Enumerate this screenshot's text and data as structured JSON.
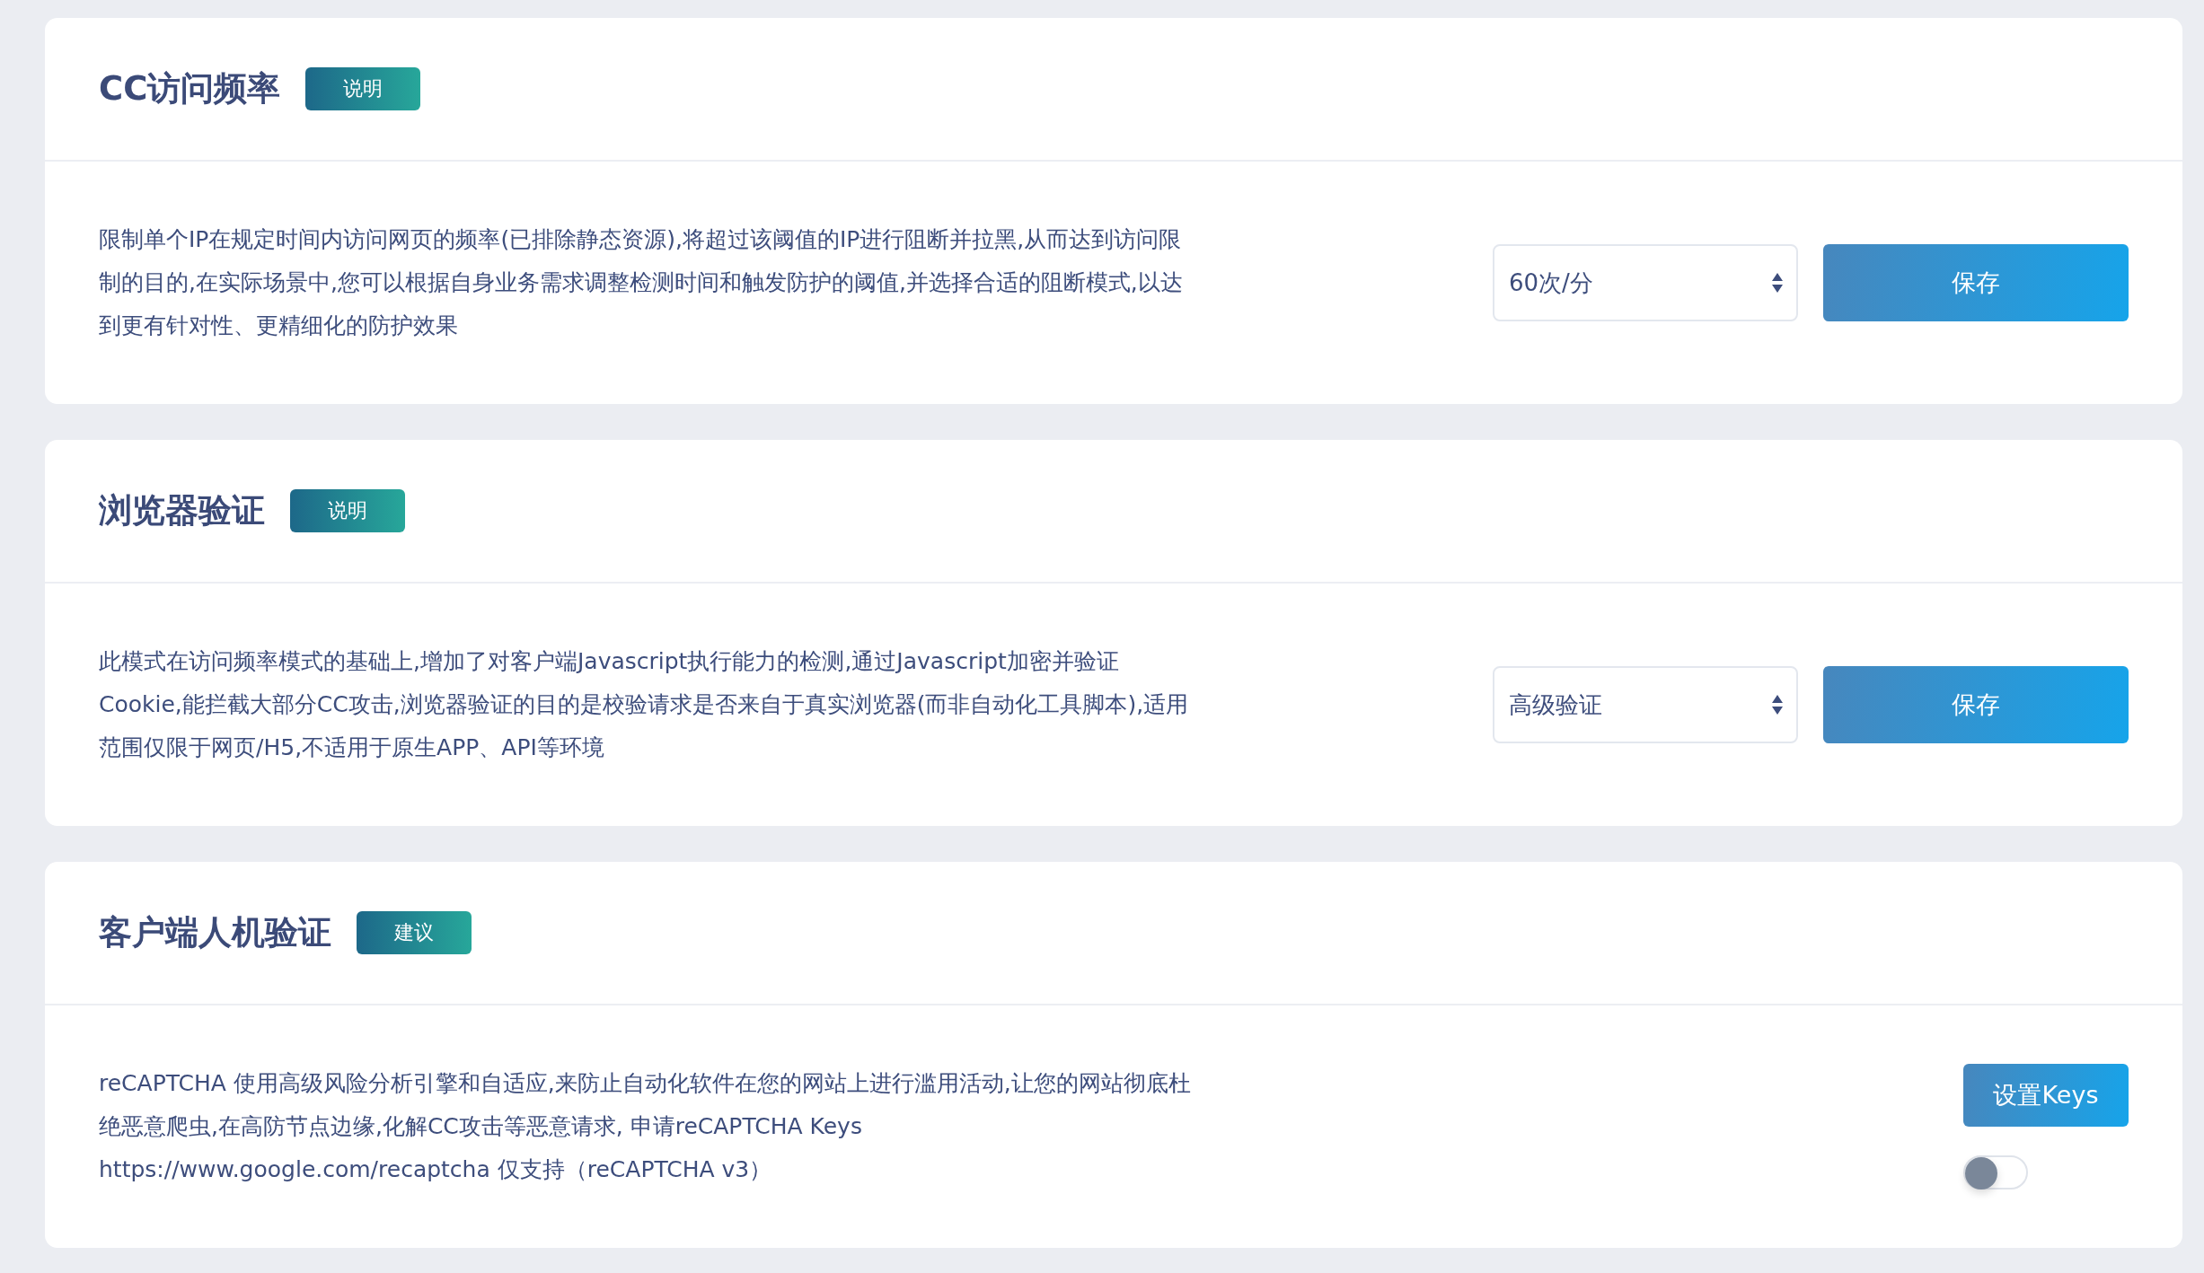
{
  "sections": [
    {
      "title": "CC访问频率",
      "badge": "说明",
      "description": "限制单个IP在规定时间内访问网页的频率(已排除静态资源),将超过该阈值的IP进行阻断并拉黑,从而达到访问限制的目的,在实际场景中,您可以根据自身业务需求调整检测时间和触发防护的阈值,并选择合适的阻断模式,以达到更有针对性、更精细化的防护效果",
      "control": {
        "kind": "select",
        "value": "60次/分",
        "button": "保存"
      }
    },
    {
      "title": "浏览器验证",
      "badge": "说明",
      "description": "此模式在访问频率模式的基础上,增加了对客户端Javascript执行能力的检测,通过Javascript加密并验证Cookie,能拦截大部分CC攻击,浏览器验证的目的是校验请求是否来自于真实浏览器(而非自动化工具脚本),适用范围仅限于网页/H5,不适用于原生APP、API等环境",
      "control": {
        "kind": "select",
        "value": "高级验证",
        "button": "保存"
      }
    },
    {
      "title": "客户端人机验证",
      "badge": "建议",
      "description": "reCAPTCHA 使用高级风险分析引擎和自适应,来防止自动化软件在您的网站上进行滥用活动,让您的网站彻底杜绝恶意爬虫,在高防节点边缘,化解CC攻击等恶意请求, 申请reCAPTCHA Keys https://www.google.com/recaptcha 仅支持（reCAPTCHA v3）",
      "control": {
        "kind": "keys",
        "button": "设置Keys",
        "toggle": {
          "on": false
        }
      }
    }
  ]
}
